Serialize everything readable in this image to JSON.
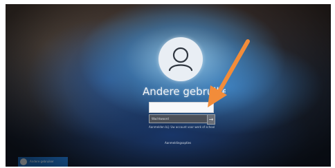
{
  "login": {
    "username": "Andere gebruike",
    "password_placeholder": "Wachtwoord",
    "submit_symbol": "→",
    "domain_hint": "Aanmelden bij: Uw account voor werk of school",
    "signin_options": "Aanmeldingsopties"
  },
  "user_tile": {
    "label": "Andere gebruiker"
  },
  "annotation": {
    "arrow_color": "#f28c3a"
  },
  "icons": {
    "avatar": "user-silhouette-icon",
    "tile_avatar": "user-silhouette-icon"
  }
}
